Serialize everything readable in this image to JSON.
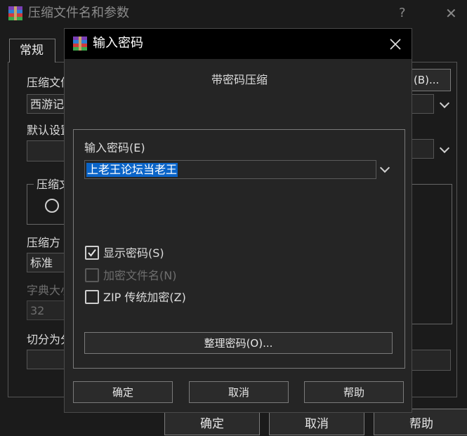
{
  "main_window": {
    "title": "压缩文件名和参数",
    "help_glyph": "?",
    "close_glyph": "✕",
    "tab_general": "常规",
    "archive_name_label": "压缩文件",
    "archive_name_value": "西游记",
    "browse_button": "(B)...",
    "default_settings_label": "默认设置",
    "archive_format_label": "压缩文",
    "compression_method_label": "压缩方",
    "compression_method_value": "标准",
    "dictionary_size_label": "字典大小",
    "dictionary_size_value": "32",
    "split_label": "切分为分",
    "ok_button": "确定",
    "cancel_button": "取消",
    "help_button": "帮助"
  },
  "dialog": {
    "title": "输入密码",
    "heading": "带密码压缩",
    "password_label": "输入密码(E)",
    "password_value": "上老王论坛当老王",
    "show_password_label": "显示密码(S)",
    "show_password_checked": true,
    "encrypt_filenames_label": "加密文件名(N)",
    "encrypt_filenames_enabled": false,
    "zip_legacy_label": "ZIP 传统加密(Z)",
    "zip_legacy_checked": false,
    "organize_button": "整理密码(O)...",
    "ok_button": "确定",
    "cancel_button": "取消",
    "help_button": "帮助"
  },
  "colors": {
    "background": "#1b1b1b",
    "dialog_bg": "#252525",
    "titlebar_bg": "#000000",
    "selection": "#0a64c8",
    "text": "#dcdcdc",
    "disabled_text": "#6e6e6e"
  }
}
